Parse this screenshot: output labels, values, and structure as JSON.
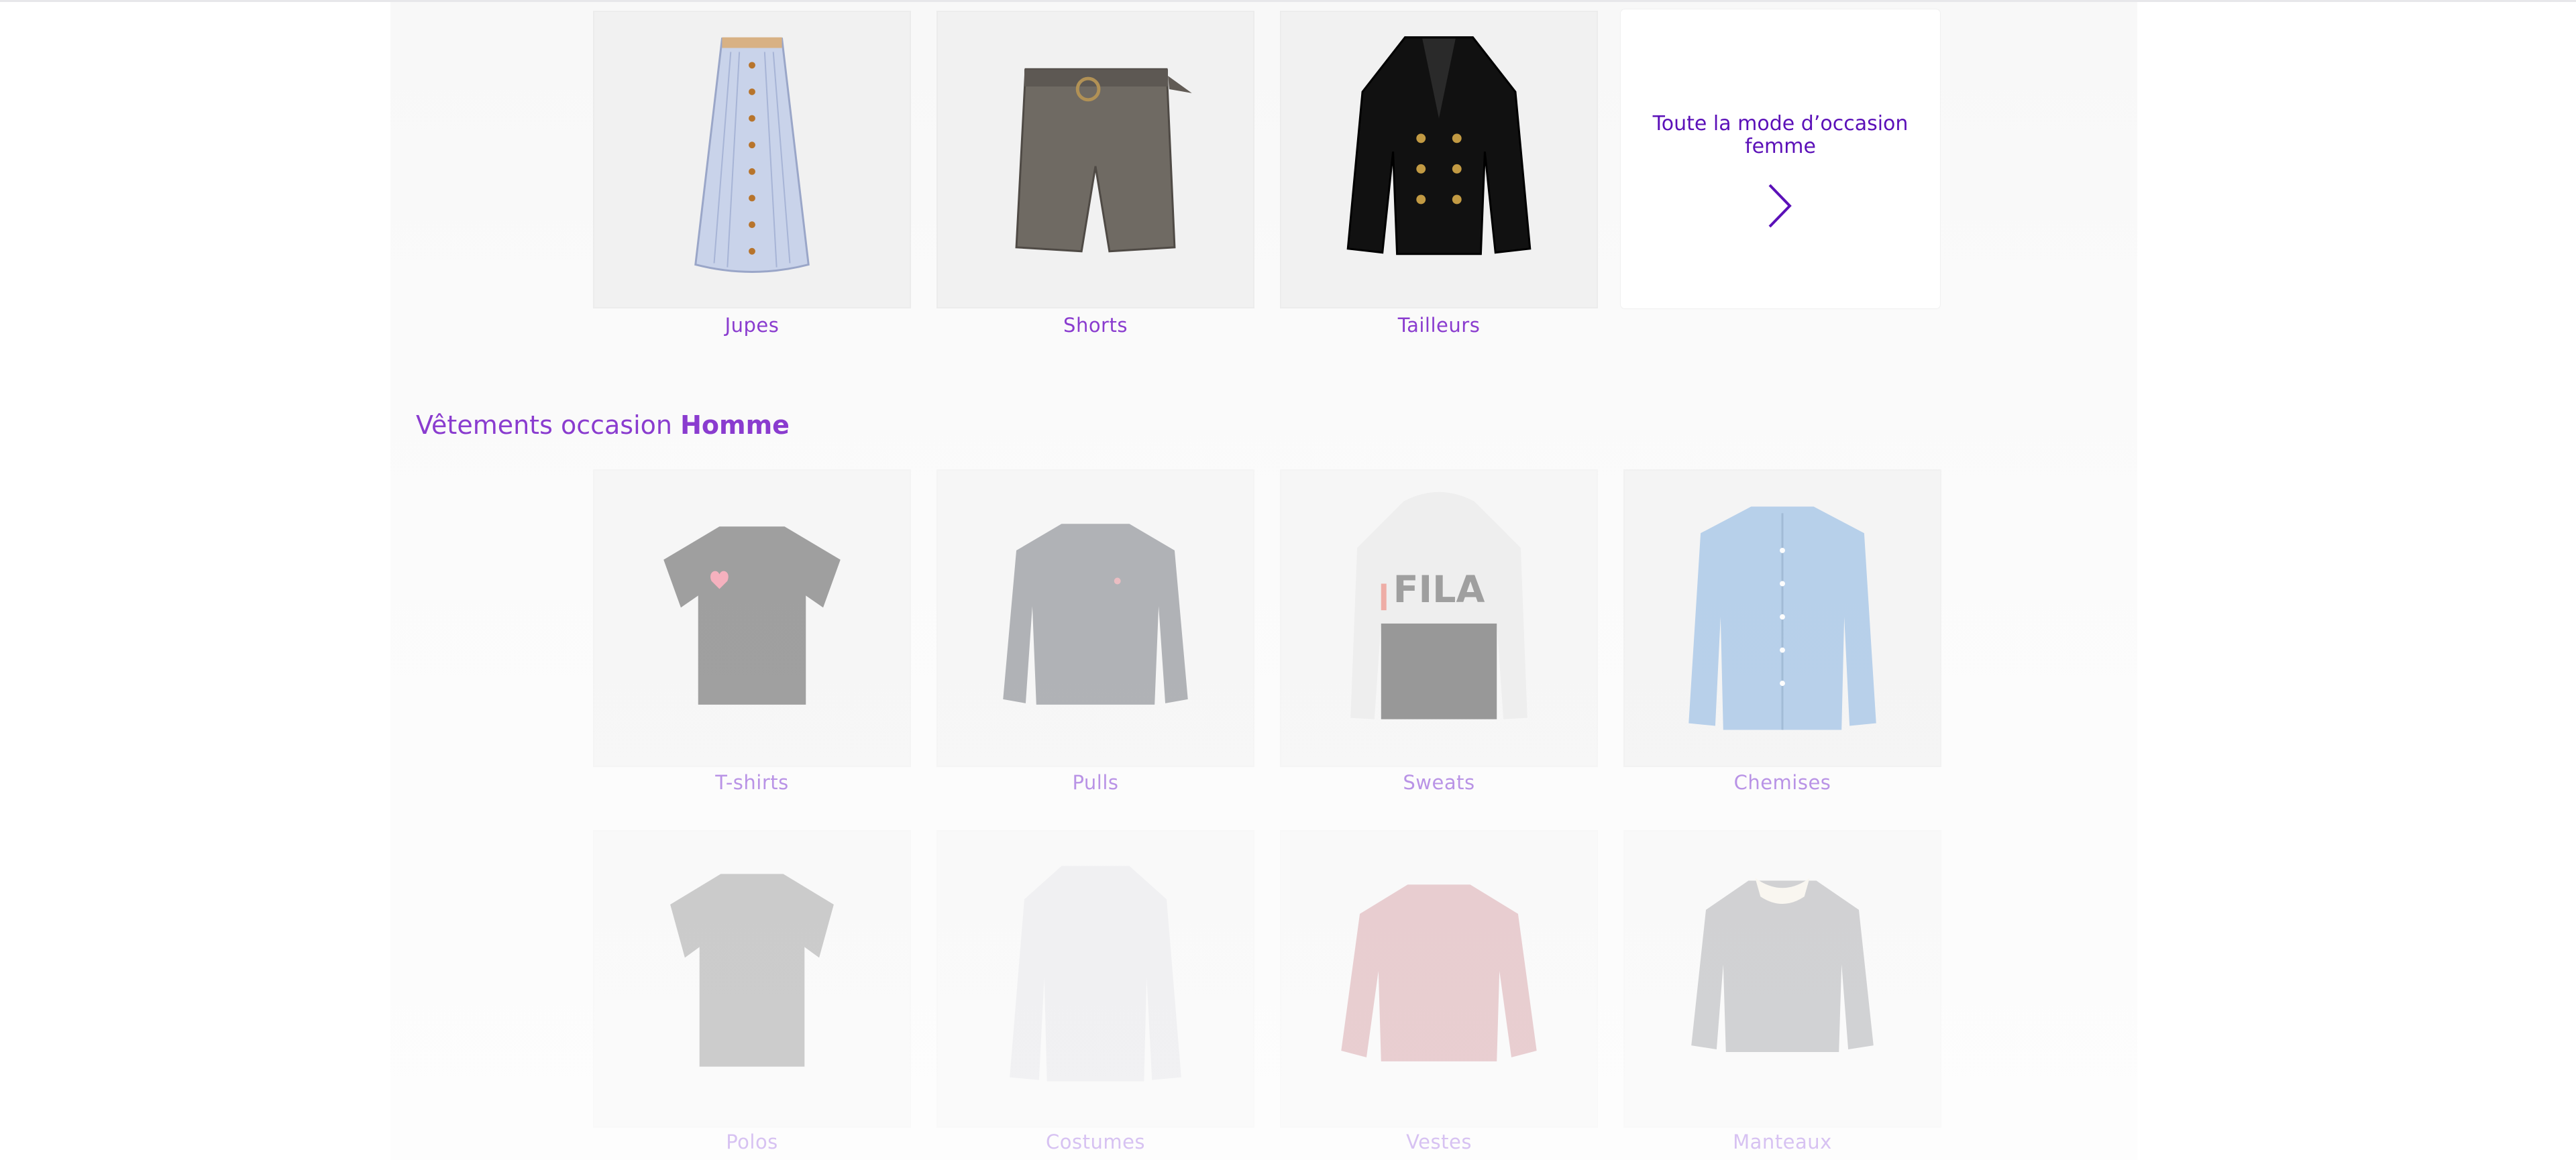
{
  "women_section": {
    "categories": [
      {
        "label": "Jupes",
        "icon": "skirt-icon"
      },
      {
        "label": "Shorts",
        "icon": "shorts-icon"
      },
      {
        "label": "Tailleurs",
        "icon": "blazer-icon"
      }
    ],
    "see_all": {
      "label": "Toute la mode d’occasion femme",
      "icon": "chevron-right-icon"
    }
  },
  "men_section": {
    "title_prefix": "Vêtements occasion",
    "title_emphasis": "Homme",
    "row1": [
      {
        "label": "T-shirts",
        "icon": "tshirt-icon"
      },
      {
        "label": "Pulls",
        "icon": "sweater-icon"
      },
      {
        "label": "Sweats",
        "icon": "hoodie-icon"
      },
      {
        "label": "Chemises",
        "icon": "shirt-icon"
      }
    ],
    "row2": [
      {
        "label": "Polos",
        "icon": "polo-icon"
      },
      {
        "label": "Costumes",
        "icon": "suit-icon"
      },
      {
        "label": "Vestes",
        "icon": "jacket-icon"
      },
      {
        "label": "Manteaux",
        "icon": "coat-icon"
      }
    ]
  },
  "colors": {
    "accent": "#8a3ccf",
    "link": "#5b10b8"
  }
}
